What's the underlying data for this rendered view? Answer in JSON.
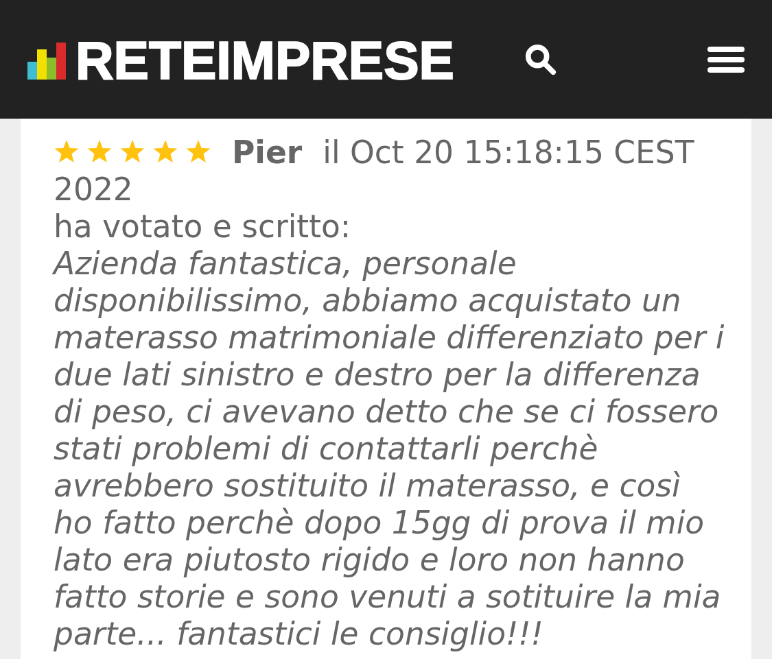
{
  "header": {
    "logo_text": "RETEIMPRESE"
  },
  "review": {
    "stars": 5,
    "author": "Pier",
    "date": "il Oct 20 15:18:15 CEST 2022",
    "intro": "ha votato e scritto:",
    "text": "Azienda fantastica, personale disponibilissimo, abbiamo acquistato un materasso matrimoniale differenziato per i due lati sinistro e destro per la differenza di peso, ci avevano detto che se ci fossero stati problemi di contattarli perchè avrebbero sostituito il materasso, e così ho fatto perchè dopo 15gg di prova il mio lato era piutosto rigido e loro non hanno fatto storie e sono venuti a sotituire la mia parte... fantastici le consiglio!!!"
  }
}
